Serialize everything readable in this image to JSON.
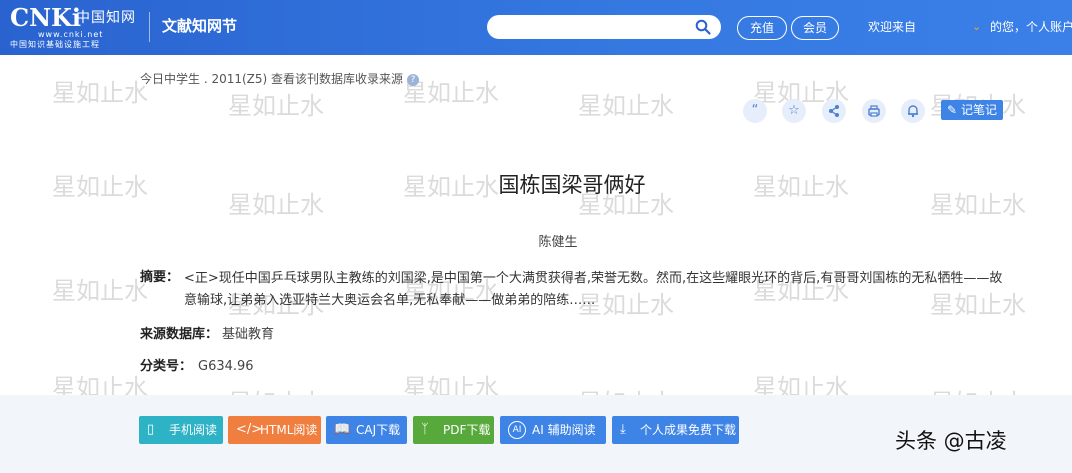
{
  "header": {
    "logo_main": "CNKi",
    "logo_cn": "中国知网",
    "logo_url": "www.cnki.net",
    "logo_sub": "中国知识基础设施工程",
    "site_title": "文献知网节",
    "search_value": "",
    "recharge_label": "充值",
    "member_label": "会员",
    "welcome": "欢迎来自",
    "account": "的您，个人账户"
  },
  "breadcrumb": {
    "text": "今日中学生 . 2011(Z5)  查看该刊数据库收录来源",
    "help": "?"
  },
  "toolbar": {
    "note_label": "记笔记"
  },
  "article": {
    "title": "国栋国梁哥俩好",
    "author": "陈健生",
    "abstract_label": "摘要：",
    "abstract": "<正>现任中国乒乓球男队主教练的刘国梁,是中国第一个大满贯获得者,荣誉无数。然而,在这些耀眼光环的背后,有哥哥刘国栋的无私牺牲——故意输球,让弟弟入选亚特兰大奥运会名单,无私奉献——做弟弟的陪练……",
    "source_label": "来源数据库：",
    "source": "基础教育",
    "class_label": "分类号：",
    "class_no": "G634.96"
  },
  "actions": [
    {
      "label": "手机阅读",
      "icon": "phone-icon",
      "color": "#2db2c6"
    },
    {
      "label": "HTML阅读",
      "icon": "code-icon",
      "color": "#f07e3e"
    },
    {
      "label": "CAJ下载",
      "icon": "book-icon",
      "color": "#3d84e6"
    },
    {
      "label": "PDF下载",
      "icon": "pdf-icon",
      "color": "#57a93b"
    },
    {
      "label": "AI 辅助阅读",
      "icon": "ai-icon",
      "color": "#3d84e6"
    },
    {
      "label": "个人成果免费下载",
      "icon": "download-icon",
      "color": "#3d84e6"
    }
  ],
  "watermark": "星如止水",
  "credit": "头条 @古凌",
  "colors": {
    "header": "#2f6fd8",
    "accent": "#3d84e6",
    "title_text": "#222222"
  }
}
